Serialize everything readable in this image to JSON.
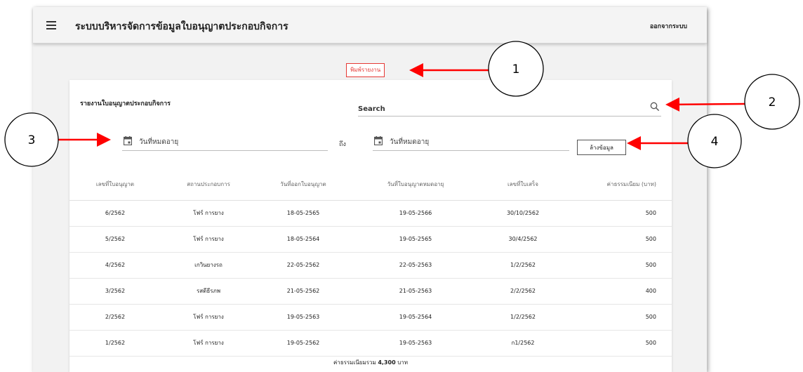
{
  "app": {
    "title": "ระบบบริหารจัดการข้อมูลใบอนุญาตประกอบกิจการ",
    "logout_label": "ออกจากระบบ"
  },
  "toolbar": {
    "print_label": "พิมพ์รายงาน"
  },
  "report": {
    "title": "รายงานใบอนุญาตประกอบกิจการ",
    "search_placeholder": "Search",
    "date_from_placeholder": "วันที่หมดอายุ",
    "to_label": "ถึง",
    "date_to_placeholder": "วันที่หมดอายุ",
    "clear_label": "ล้างข้อมูล",
    "columns": [
      "เลขที่ใบอนุญาต",
      "สถานประกอบการ",
      "วันที่ออกใบอนุญาต",
      "วันที่ใบอนุญาตหมดอายุ",
      "เลขที่ใบเสร็จ",
      "ค่าธรรมเนียม (บาท)"
    ],
    "rows": [
      [
        "6/2562",
        "โฟร์ การยาง",
        "18-05-2565",
        "19-05-2566",
        "30/10/2562",
        "500"
      ],
      [
        "5/2562",
        "โฟร์ การยาง",
        "18-05-2564",
        "19-05-2565",
        "30/4/2562",
        "500"
      ],
      [
        "4/2562",
        "เกวินยางรถ",
        "22-05-2562",
        "22-05-2563",
        "1/2/2562",
        "500"
      ],
      [
        "3/2562",
        "รสดีธีรภพ",
        "21-05-2562",
        "21-05-2563",
        "2/2/2562",
        "400"
      ],
      [
        "2/2562",
        "โฟร์ การยาง",
        "19-05-2563",
        "19-05-2564",
        "1/2/2562",
        "500"
      ],
      [
        "1/2562",
        "โฟร์ การยาง",
        "19-05-2562",
        "19-05-2563",
        "ก1/2562",
        "500"
      ]
    ],
    "total_prefix": "ค่าธรรมเนียมรวม",
    "total_value": "4,300",
    "total_suffix": "บาท"
  },
  "annotations": [
    "1",
    "2",
    "3",
    "4"
  ],
  "colors": {
    "accent": "#e53935",
    "annotation_arrow": "#ff0000"
  }
}
